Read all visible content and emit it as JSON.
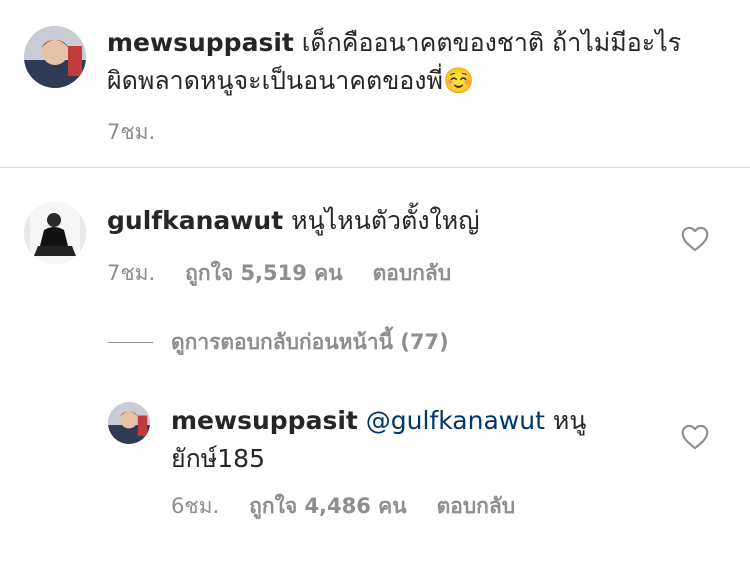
{
  "caption": {
    "username": "mewsuppasit",
    "text_line1": "เด็กคืออนาคตของชาติ ถ้าไม่มีอะไร",
    "text_line2": "ผิดพลาดหนูจะเป็นอนาคตของพี่",
    "emoji": "☺️",
    "time": "7ชม."
  },
  "comment": {
    "username": "gulfkanawut",
    "text": "หนูไหนตัวตั้งใหญ่",
    "time": "7ชม.",
    "likes": "ถูกใจ 5,519 คน",
    "reply_label": "ตอบกลับ"
  },
  "view_previous_replies": "ดูการตอบกลับก่อนหน้านี้ (77)",
  "reply": {
    "username": "mewsuppasit",
    "mention": "@gulfkanawut",
    "text_after_mention": "หนู",
    "text_line2": "ยักษ์185",
    "time": "6ชม.",
    "likes": "ถูกใจ 4,486 คน",
    "reply_label": "ตอบกลับ"
  },
  "icons": {
    "heart": "heart-outline-icon"
  }
}
